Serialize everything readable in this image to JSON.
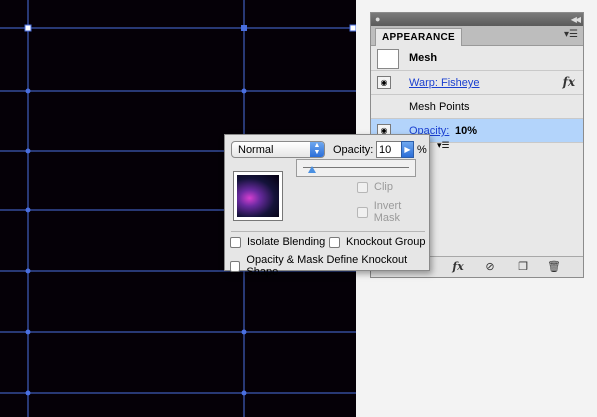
{
  "panel": {
    "tab_label": "APPEARANCE",
    "rows": {
      "mesh_label": "Mesh",
      "effect_label": "Warp: Fisheye",
      "mesh_points_label": "Mesh Points",
      "opacity_label": "Opacity:",
      "opacity_value": "10%"
    },
    "fx_label": "fx"
  },
  "popup": {
    "blend_mode": "Normal",
    "opacity_label": "Opacity:",
    "opacity_value": "10",
    "percent": "%",
    "clip_label": "Clip",
    "invert_mask_label": "Invert Mask",
    "isolate_blending_label": "Isolate Blending",
    "knockout_group_label": "Knockout Group",
    "opacity_mask_label": "Opacity & Mask Define Knockout Shape"
  },
  "colors": {
    "artboard": "#050007",
    "mesh_lines": "#4a6fe0",
    "selection": "#b3d4fb",
    "link": "#1a3fd0"
  }
}
